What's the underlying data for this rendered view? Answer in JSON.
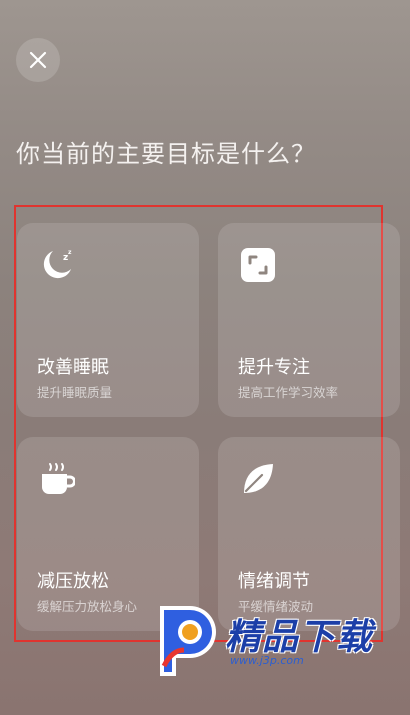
{
  "header": {
    "close_icon": "close-icon",
    "title": "你当前的主要目标是什么？"
  },
  "goals": [
    {
      "icon": "moon-sleep-icon",
      "title": "改善睡眠",
      "subtitle": "提升睡眠质量"
    },
    {
      "icon": "focus-frame-icon",
      "title": "提升专注",
      "subtitle": "提高工作学习效率"
    },
    {
      "icon": "coffee-cup-icon",
      "title": "减压放松",
      "subtitle": "缓解压力放松身心"
    },
    {
      "icon": "leaf-icon",
      "title": "情绪调节",
      "subtitle": "平缓情绪波动"
    }
  ],
  "watermark": {
    "text": "精品下载",
    "url": "www.j3p.com"
  },
  "colors": {
    "highlight": "#e0342f",
    "watermark_blue": "#1c3fa8"
  }
}
